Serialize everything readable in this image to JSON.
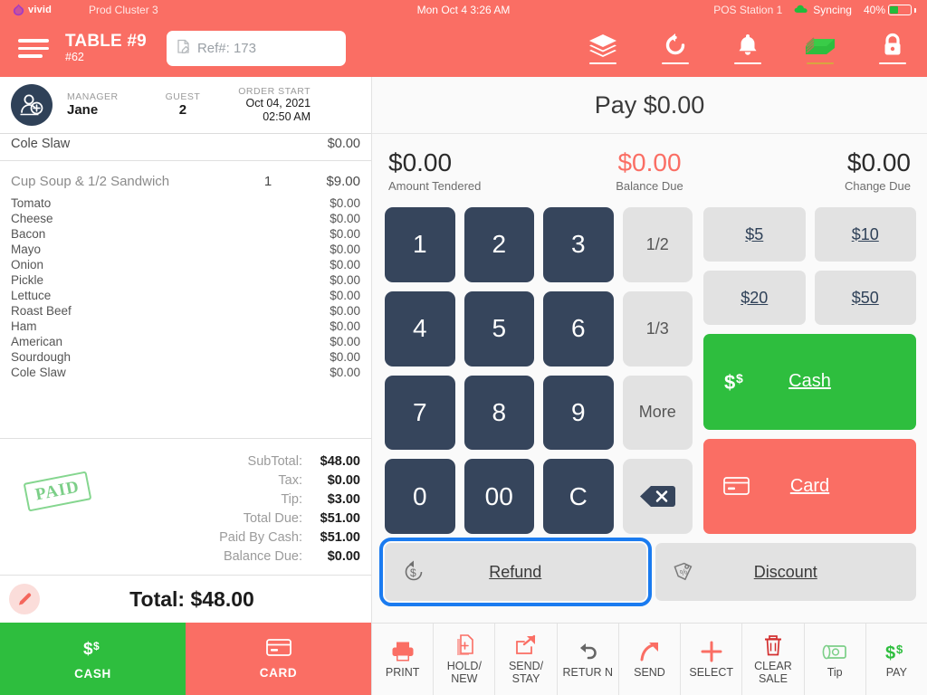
{
  "statusbar": {
    "logo_text": "vivid",
    "cluster": "Prod Cluster 3",
    "datetime": "Mon Oct 4 3:26 AM",
    "station": "POS Station 1",
    "sync_status": "Syncing",
    "battery": "40%",
    "battery_percent": 40,
    "colors": {
      "bar": "#FA6E64",
      "sync_green": "#22BB3B",
      "logo_purple": "#A23BC4"
    }
  },
  "header": {
    "table_title": "TABLE #9",
    "table_sub": "#62",
    "ref_placeholder": "Ref#: 173",
    "icons": [
      {
        "name": "layers-icon",
        "label": "Layers"
      },
      {
        "name": "refresh-icon",
        "label": "Refresh"
      },
      {
        "name": "bell-icon",
        "label": "Alerts"
      },
      {
        "name": "cash-stack-icon",
        "label": "Cash Drawer"
      },
      {
        "name": "lock-icon",
        "label": "Lock"
      }
    ]
  },
  "order_info": {
    "manager_label": "MANAGER",
    "manager_value": "Jane",
    "guest_label": "GUEST",
    "guest_value": "2",
    "order_start_label": "ORDER START",
    "order_start_date": "Oct 04, 2021",
    "order_start_time": "02:50 AM"
  },
  "order_items": {
    "top_partial": {
      "name": "Cole Slaw",
      "qty": "",
      "price": "$0.00"
    },
    "main_item": {
      "name": "Cup Soup & 1/2 Sandwich",
      "qty": "1",
      "price": "$9.00"
    },
    "modifiers": [
      {
        "name": "Tomato",
        "price": "$0.00"
      },
      {
        "name": "Cheese",
        "price": "$0.00"
      },
      {
        "name": "Bacon",
        "price": "$0.00"
      },
      {
        "name": "Mayo",
        "price": "$0.00"
      },
      {
        "name": "Onion",
        "price": "$0.00"
      },
      {
        "name": "Pickle",
        "price": "$0.00"
      },
      {
        "name": "Lettuce",
        "price": "$0.00"
      },
      {
        "name": "Roast Beef",
        "price": "$0.00"
      },
      {
        "name": "Ham",
        "price": "$0.00"
      },
      {
        "name": "American",
        "price": "$0.00"
      },
      {
        "name": "Sourdough",
        "price": "$0.00"
      },
      {
        "name": "Cole Slaw",
        "price": "$0.00"
      }
    ]
  },
  "totals": {
    "paid_stamp": "PAID",
    "rows": [
      {
        "label": "SubTotal:",
        "value": "$48.00"
      },
      {
        "label": "Tax:",
        "value": "$0.00"
      },
      {
        "label": "Tip:",
        "value": "$3.00"
      },
      {
        "label": "Total Due:",
        "value": "$51.00"
      },
      {
        "label": "Paid By Cash:",
        "value": "$51.00"
      },
      {
        "label": "Balance Due:",
        "value": "$0.00"
      }
    ],
    "grand_total": "Total: $48.00"
  },
  "left_footer": {
    "cash_label": "CASH",
    "card_label": "CARD",
    "cash_color": "#2EBE3E",
    "card_color": "#FA6E64"
  },
  "pay_panel": {
    "title": "Pay $0.00",
    "amount_tendered": {
      "value": "$0.00",
      "label": "Amount Tendered"
    },
    "balance_due": {
      "value": "$0.00",
      "label": "Balance Due",
      "color": "#FA6E64"
    },
    "change_due": {
      "value": "$0.00",
      "label": "Change Due"
    },
    "keypad": [
      {
        "key": "1",
        "type": "num"
      },
      {
        "key": "2",
        "type": "num"
      },
      {
        "key": "3",
        "type": "num"
      },
      {
        "key": "1/2",
        "type": "fn"
      },
      {
        "key": "4",
        "type": "num"
      },
      {
        "key": "5",
        "type": "num"
      },
      {
        "key": "6",
        "type": "num"
      },
      {
        "key": "1/3",
        "type": "fn"
      },
      {
        "key": "7",
        "type": "num"
      },
      {
        "key": "8",
        "type": "num"
      },
      {
        "key": "9",
        "type": "num"
      },
      {
        "key": "More",
        "type": "fn"
      },
      {
        "key": "0",
        "type": "num"
      },
      {
        "key": "00",
        "type": "num"
      },
      {
        "key": "C",
        "type": "num"
      },
      {
        "key": "backspace",
        "type": "fn"
      }
    ],
    "quick_amounts": [
      "$5",
      "$10",
      "$20",
      "$50"
    ],
    "cash_button": "Cash",
    "card_button": "Card",
    "refund_button": "Refund",
    "discount_button": "Discount",
    "focused_button": "Refund"
  },
  "toolbar": [
    {
      "label": "PRINT",
      "icon": "printer-icon",
      "color": "#FA6E64"
    },
    {
      "label": "HOLD/ NEW",
      "icon": "hold-new-icon",
      "color": "#FA6E64"
    },
    {
      "label": "SEND/ STAY",
      "icon": "send-stay-icon",
      "color": "#FA6E64"
    },
    {
      "label": "RETUR N",
      "icon": "return-icon",
      "color": "#666666"
    },
    {
      "label": "SEND",
      "icon": "send-icon",
      "color": "#FA6E64"
    },
    {
      "label": "SELECT",
      "icon": "plus-icon",
      "color": "#FA6E64"
    },
    {
      "label": "CLEAR SALE",
      "icon": "trash-icon",
      "color": "#D32F2F"
    },
    {
      "label": "Tip",
      "icon": "money-roll-icon",
      "color": "#7CCF88"
    },
    {
      "label": "PAY",
      "icon": "dollar-icon",
      "color": "#2EBE3E"
    }
  ]
}
